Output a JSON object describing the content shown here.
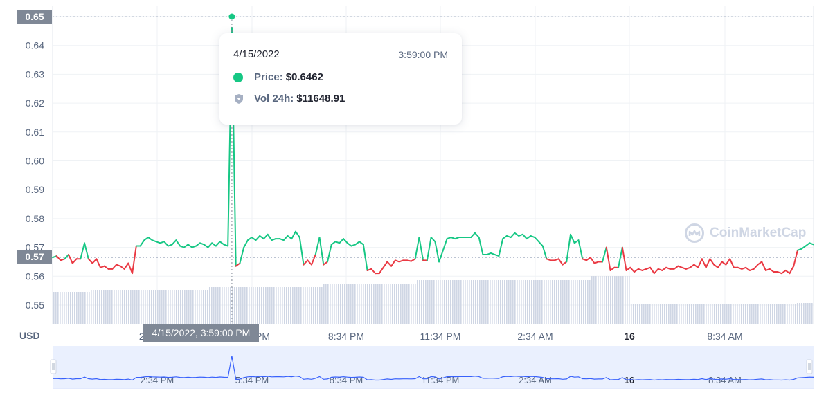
{
  "chart_data": {
    "type": "line",
    "currency_label": "USD",
    "ylim": [
      0.543,
      0.653
    ],
    "y_ticks": [
      "0.55",
      "0.56",
      "0.57",
      "0.58",
      "0.59",
      "0.60",
      "0.61",
      "0.62",
      "0.63",
      "0.64",
      "0.65"
    ],
    "x_ticks": [
      "2:34 PM",
      "5:34 PM",
      "8:34 PM",
      "11:34 PM",
      "2:34 AM",
      "16",
      "8:34 AM"
    ],
    "baseline_price": 0.5665,
    "y_highlight_labels": [
      "0.65",
      "0.57"
    ],
    "x_highlight_label": "4/15/2022, 3:59:00 PM",
    "price": [
      0.5665,
      0.567,
      0.5655,
      0.566,
      0.5675,
      0.5645,
      0.566,
      0.566,
      0.5715,
      0.566,
      0.5645,
      0.566,
      0.563,
      0.5635,
      0.5625,
      0.5625,
      0.564,
      0.5635,
      0.5625,
      0.5645,
      0.561,
      0.5705,
      0.5705,
      0.5725,
      0.5735,
      0.5725,
      0.572,
      0.5715,
      0.572,
      0.5705,
      0.571,
      0.5725,
      0.5705,
      0.57,
      0.571,
      0.57,
      0.5705,
      0.5715,
      0.571,
      0.57,
      0.5715,
      0.5705,
      0.572,
      0.571,
      0.5705,
      0.6462,
      0.5635,
      0.5645,
      0.57,
      0.5725,
      0.5735,
      0.5725,
      0.574,
      0.573,
      0.5745,
      0.5725,
      0.573,
      0.573,
      0.5725,
      0.574,
      0.573,
      0.5755,
      0.5735,
      0.564,
      0.5655,
      0.564,
      0.5675,
      0.5735,
      0.564,
      0.565,
      0.571,
      0.572,
      0.5715,
      0.573,
      0.5715,
      0.5705,
      0.571,
      0.572,
      0.571,
      0.562,
      0.5625,
      0.561,
      0.561,
      0.563,
      0.565,
      0.5635,
      0.5655,
      0.565,
      0.5655,
      0.5655,
      0.5652,
      0.566,
      0.5735,
      0.5655,
      0.5655,
      0.5735,
      0.572,
      0.565,
      0.569,
      0.573,
      0.5735,
      0.573,
      0.5735,
      0.5735,
      0.5735,
      0.5735,
      0.575,
      0.5735,
      0.5675,
      0.5675,
      0.568,
      0.5675,
      0.567,
      0.573,
      0.574,
      0.5735,
      0.575,
      0.574,
      0.5745,
      0.573,
      0.574,
      0.5735,
      0.572,
      0.5705,
      0.566,
      0.5655,
      0.5655,
      0.566,
      0.564,
      0.565,
      0.5745,
      0.5715,
      0.5725,
      0.566,
      0.5655,
      0.5665,
      0.5645,
      0.565,
      0.565,
      0.57,
      0.562,
      0.563,
      0.563,
      0.57,
      0.562,
      0.563,
      0.5615,
      0.5625,
      0.562,
      0.5625,
      0.563,
      0.561,
      0.5625,
      0.562,
      0.563,
      0.5625,
      0.5625,
      0.5635,
      0.563,
      0.5625,
      0.563,
      0.564,
      0.563,
      0.566,
      0.563,
      0.566,
      0.564,
      0.563,
      0.565,
      0.564,
      0.566,
      0.563,
      0.563,
      0.5625,
      0.563,
      0.562,
      0.5625,
      0.564,
      0.565,
      0.562,
      0.5625,
      0.5615,
      0.5615,
      0.561,
      0.562,
      0.561,
      0.5635,
      0.569,
      0.5695,
      0.5705,
      0.5715,
      0.571
    ],
    "highlight_point": {
      "date": "4/15/2022",
      "time": "3:59:00 PM",
      "price": 0.6462
    }
  },
  "tooltip": {
    "date": "4/15/2022",
    "time": "3:59:00 PM",
    "price_label": "Price:",
    "price_value": "$0.6462",
    "vol_label": "Vol 24h:",
    "vol_value": "$11648.91"
  },
  "watermark": "CoinMarketCap",
  "colors": {
    "up": "#16c784",
    "down": "#ea3943",
    "grid": "#eff2f5",
    "axis_text": "#58667e",
    "volume": "#cfd6e4",
    "navigator_fill": "#eaf0fe",
    "navigator_line": "#3861fb",
    "label_box": "#7f8896"
  }
}
